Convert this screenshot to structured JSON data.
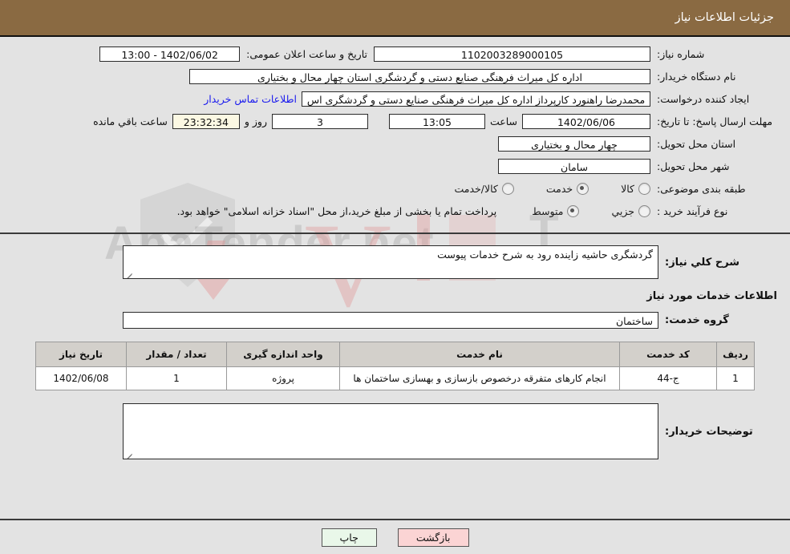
{
  "header": {
    "title": "جزئیات اطلاعات نیاز"
  },
  "form": {
    "need_number_label": "شماره نیاز:",
    "need_number_value": "1102003289000105",
    "public_announce_label": "تاریخ و ساعت اعلان عمومی:",
    "public_announce_value": "1402/06/02 - 13:00",
    "buyer_org_label": "نام دستگاه خریدار:",
    "buyer_org_value": "اداره کل میراث فرهنگی  صنایع دستی و گردشگری استان چهار محال و بختیاری",
    "creator_label": "ایجاد کننده درخواست:",
    "creator_value": "محمدرضا راهنورد کارپرداز اداره کل میراث فرهنگی  صنایع دستی و گردشگری اس",
    "contact_link": "اطلاعات تماس خریدار",
    "deadline_label": "مهلت ارسال پاسخ: تا تاریخ:",
    "deadline_date": "1402/06/06",
    "hour_label": "ساعت",
    "hour_value": "13:05",
    "days_value": "3",
    "days_label": "روز و",
    "remaining_value": "23:32:34",
    "remaining_label": "ساعت باقي مانده",
    "province_label": "استان محل تحویل:",
    "province_value": "چهار محال و بختیاری",
    "city_label": "شهر محل تحویل:",
    "city_value": "سامان",
    "category_label": "طبقه بندی موضوعی:",
    "category_options": [
      {
        "label": "کالا",
        "selected": false
      },
      {
        "label": "خدمت",
        "selected": true
      },
      {
        "label": "کالا/خدمت",
        "selected": false
      }
    ],
    "purchase_type_label": "نوع فرآیند خرید :",
    "purchase_type_options": [
      {
        "label": "جزیي",
        "selected": false
      },
      {
        "label": "متوسط",
        "selected": true
      }
    ],
    "purchase_note": "پرداخت تمام یا بخشی از مبلغ خرید،از محل \"اسناد خزانه اسلامی\" خواهد بود."
  },
  "description": {
    "general_need_label": "شرح کلي نیاز:",
    "general_need_value": "گردشگری حاشیه زاینده رود به شرح خدمات پیوست",
    "services_info_header": "اطلاعات خدمات مورد نیاز",
    "service_group_label": "گروه خدمت:",
    "service_group_value": "ساختمان"
  },
  "table": {
    "columns": [
      "ردیف",
      "کد خدمت",
      "نام خدمت",
      "واحد اندازه گیری",
      "تعداد / مقدار",
      "تاریخ نیاز"
    ],
    "rows": [
      {
        "radif": "1",
        "code": "ج-44",
        "name": "انجام کارهای متفرقه درخصوص بازسازی و بهسازی ساختمان ها",
        "unit": "پروژه",
        "qty": "1",
        "date": "1402/06/08"
      }
    ]
  },
  "comments": {
    "label": "توضیحات خریدار:",
    "value": ""
  },
  "footer": {
    "print_label": "چاپ",
    "back_label": "بازگشت"
  },
  "watermark": {
    "text": "AnaTender",
    "suffix": ".net"
  },
  "colors": {
    "header_bg": "#8a6a42",
    "page_bg": "#e3e3e3",
    "link": "#1a1aee",
    "table_header_bg": "#d3d0cb",
    "print_btn": "#e9f7e9",
    "back_btn": "#fbd4d4",
    "cream_field": "#fbf8e3"
  }
}
